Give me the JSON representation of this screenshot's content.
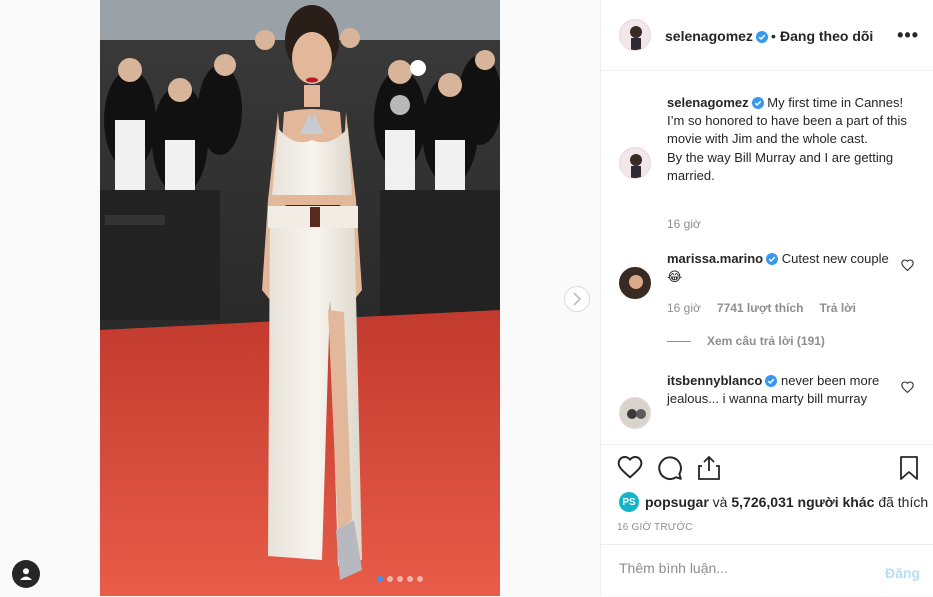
{
  "post": {
    "author": "selenagomez",
    "follow_sep": "•",
    "follow_label": "Đang theo dõi",
    "more_label": "•••"
  },
  "caption": {
    "user": "selenagomez",
    "text": "My first time in Cannes! I’m so honored to have been a part of this movie with Jim and the whole cast.",
    "text2": "By the way Bill Murray and I are getting married.",
    "time": "16 giờ"
  },
  "comments": [
    {
      "user": "marissa.marino",
      "text": "Cutest new couple 😂",
      "time": "16 giờ",
      "likes": "7741 lượt thích",
      "reply": "Trả lời",
      "view_replies": "Xem câu trả lời (191)"
    },
    {
      "user": "itsbennyblanco",
      "text": "never been more jealous... i wanna marty bill murray"
    }
  ],
  "likes": {
    "badge": "PS",
    "user": "popsugar",
    "connector": "và",
    "others": "5,726,031 người khác",
    "suffix": "đã thích"
  },
  "time_ago": "16 GIỜ TRƯỚC",
  "comment_box": {
    "placeholder": "Thêm bình luận...",
    "post_label": "Đăng"
  },
  "carousel": {
    "count": 5,
    "active": 0
  },
  "colors": {
    "accent": "#3897f0",
    "carpet": "#e04a3a",
    "dress": "#f3efe8"
  }
}
